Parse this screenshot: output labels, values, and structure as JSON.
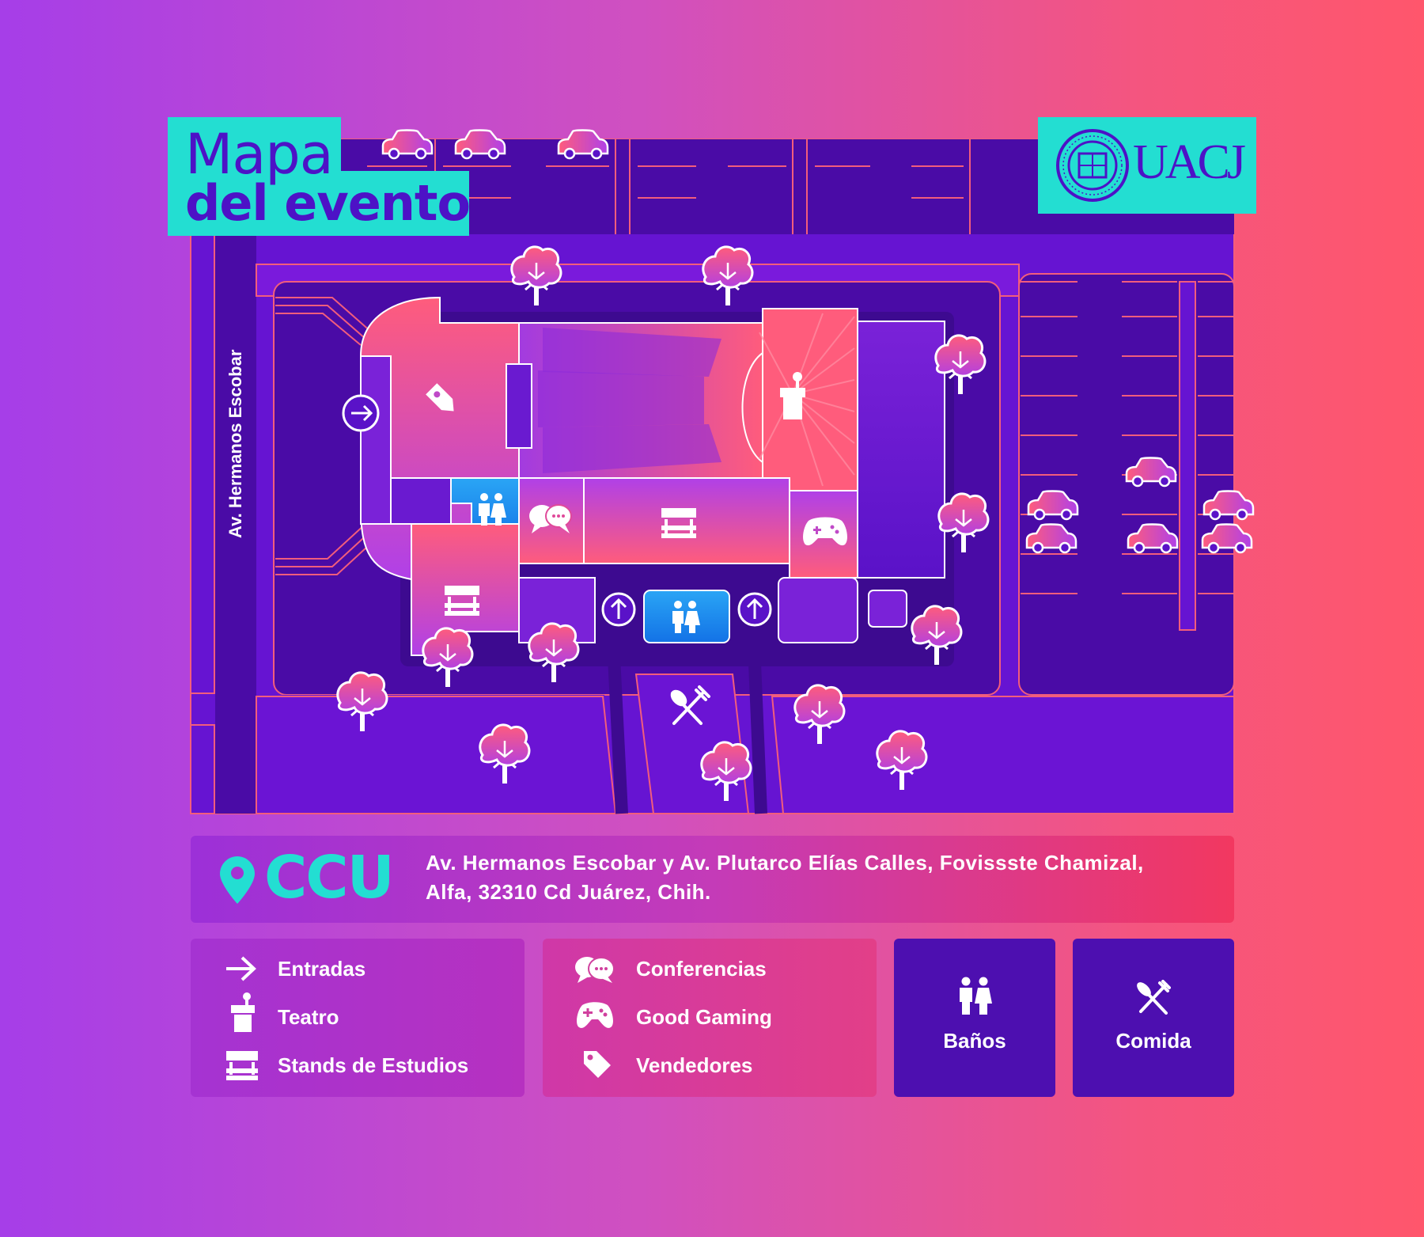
{
  "title": {
    "line1": "Mapa",
    "line2": "del evento"
  },
  "logo": {
    "text": "UACJ",
    "seal_text": "UNIVERSIDAD AUTÓNOMA DE CIUDAD JUÁREZ"
  },
  "map": {
    "street_label": "Av. Hermanos Escobar",
    "icons": [
      "entrance-arrow-icon",
      "vendor-tag-icon",
      "podium-icon",
      "restroom-icon",
      "conference-chat-icon",
      "stand-icon",
      "gamepad-icon",
      "food-icon",
      "tree-icon",
      "car-icon"
    ]
  },
  "location": {
    "name": "CCU",
    "address_line1": "Av. Hermanos Escobar y Av. Plutarco Elías Calles, Fovissste Chamizal,",
    "address_line2": "Alfa, 32310 Cd Juárez, Chih."
  },
  "legend": {
    "left": [
      {
        "icon": "arrow-right-icon",
        "label": "Entradas"
      },
      {
        "icon": "podium-icon",
        "label": "Teatro"
      },
      {
        "icon": "stand-icon",
        "label": "Stands de Estudios"
      }
    ],
    "middle": [
      {
        "icon": "chat-icon",
        "label": "Conferencias"
      },
      {
        "icon": "gamepad-icon",
        "label": "Good Gaming"
      },
      {
        "icon": "tag-icon",
        "label": "Vendedores"
      }
    ],
    "boxes": [
      {
        "icon": "restroom-icon",
        "label": "Baños"
      },
      {
        "icon": "food-icon",
        "label": "Comida"
      }
    ]
  },
  "colors": {
    "accent": "#23ded2",
    "deep_purple": "#4d12c6",
    "pink": "#ff566c",
    "blue_room": "#1a8ef0"
  }
}
